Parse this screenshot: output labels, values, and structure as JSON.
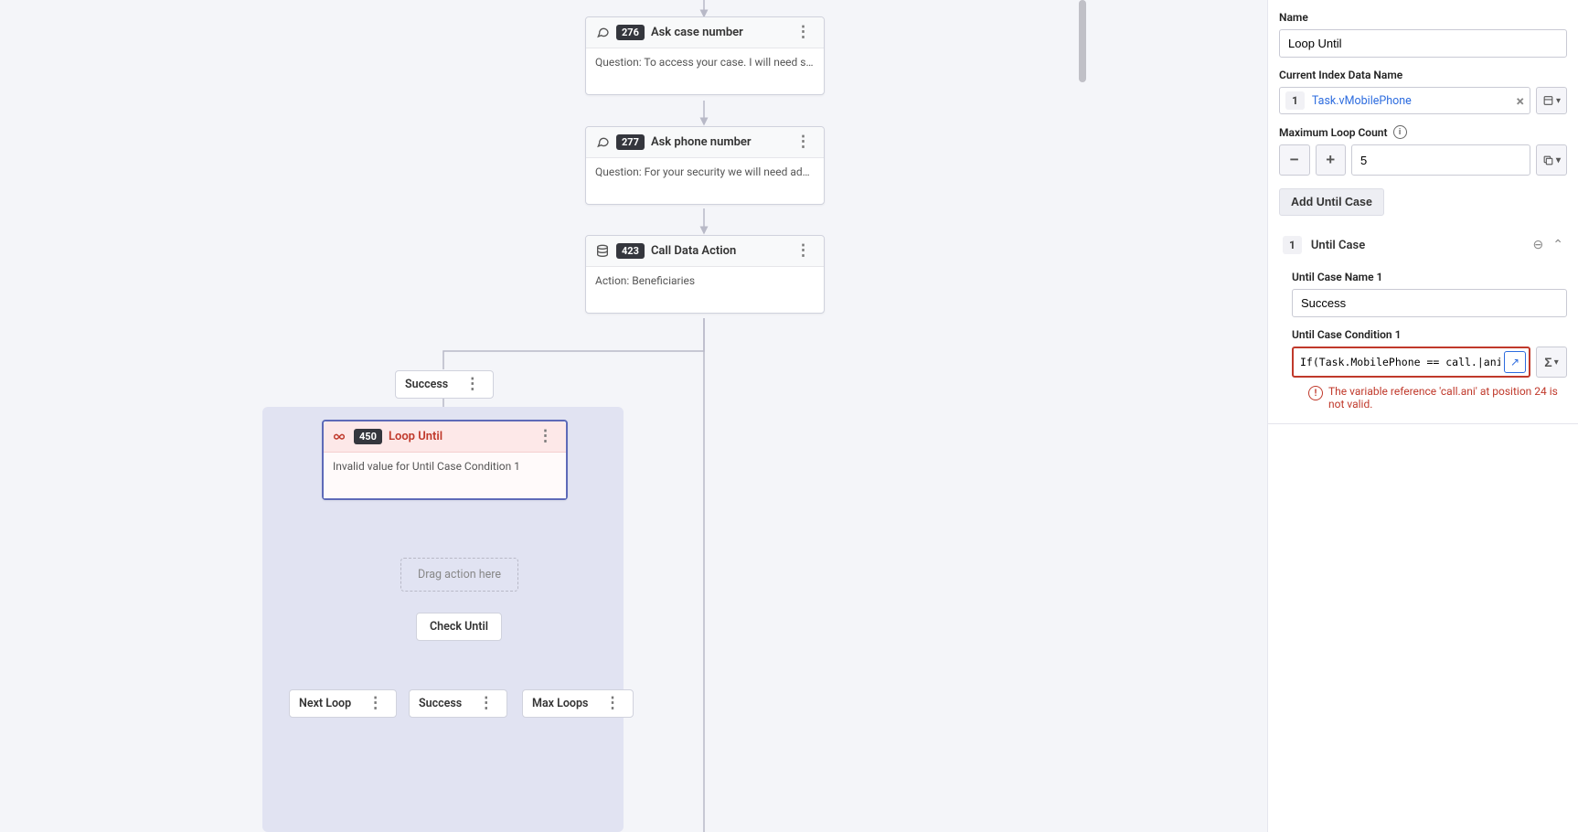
{
  "nodes": {
    "ask_case": {
      "id": "276",
      "title": "Ask case number",
      "body": "Question: To access your case. I will need some in…"
    },
    "ask_phone": {
      "id": "277",
      "title": "Ask phone number",
      "body": "Question: For your security we will need additional…"
    },
    "data_act": {
      "id": "423",
      "title": "Call Data Action",
      "body": "Action: Beneficiaries"
    },
    "loop": {
      "id": "450",
      "title": "Loop Until",
      "body": "Invalid value for Until Case Condition 1"
    }
  },
  "chips": {
    "success_top": "Success",
    "drop": "Drag action here",
    "check": "Check Until",
    "next": "Next Loop",
    "success_bot": "Success",
    "max": "Max Loops"
  },
  "panel": {
    "name_label": "Name",
    "name_value": "Loop Until",
    "idx_label": "Current Index Data Name",
    "idx_badge": "1",
    "idx_value": "Task.vMobilePhone",
    "max_label": "Maximum Loop Count",
    "max_value": "5",
    "add_case": "Add Until Case",
    "case_badge": "1",
    "case_hdr": "Until Case",
    "case_name_label": "Until Case Name 1",
    "case_name_value": "Success",
    "cond_label": "Until Case Condition 1",
    "cond_value": "If(Task.MobilePhone == call.|ani)",
    "err": "The variable reference 'call.ani' at position 24 is not valid."
  }
}
